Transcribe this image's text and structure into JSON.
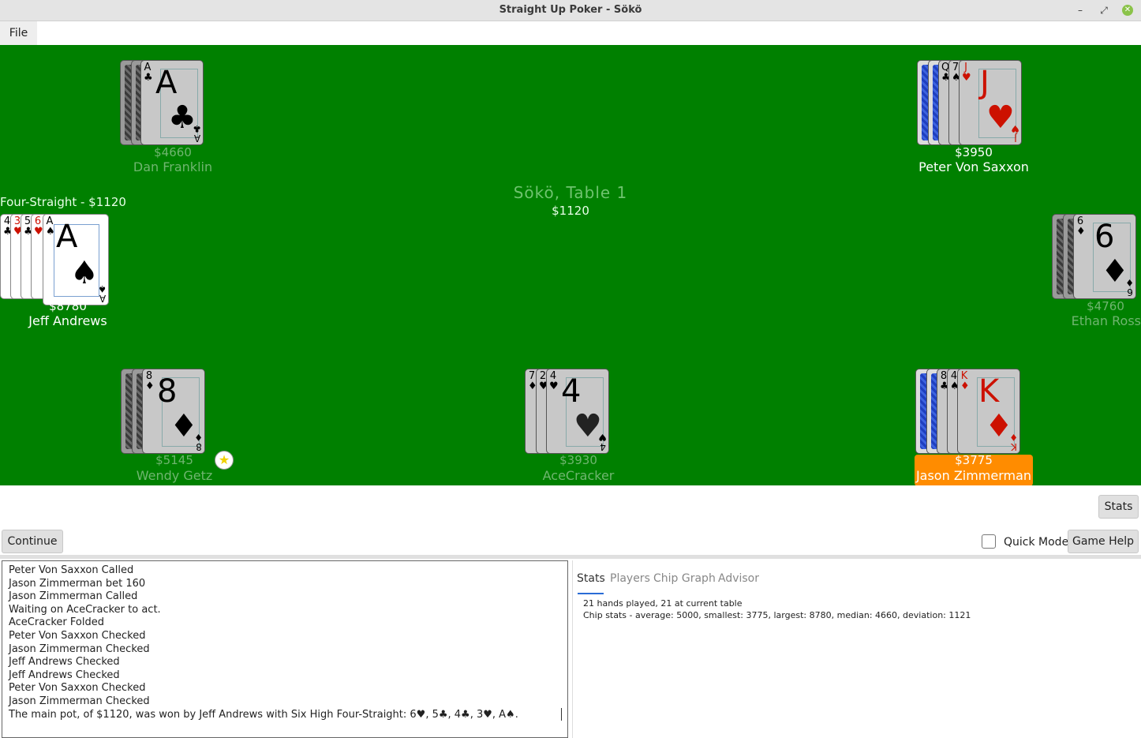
{
  "window": {
    "title": "Straight Up Poker - Sökö",
    "minimize_icon": "–",
    "restore_icon": "⤢",
    "close_icon": "✕"
  },
  "menu": {
    "file": "File"
  },
  "table": {
    "title": "Sökö, Table 1",
    "pot": "$1120",
    "winner_label": "Four-Straight - $1120"
  },
  "players": {
    "dan": {
      "name": "Dan Franklin",
      "chips": "$4660"
    },
    "peter": {
      "name": "Peter Von Saxxon",
      "chips": "$3950"
    },
    "jeff": {
      "name": "Jeff Andrews",
      "chips": "$8780"
    },
    "ethan": {
      "name": "Ethan Ross",
      "chips": "$4760"
    },
    "wendy": {
      "name": "Wendy Getz",
      "chips": "$5145"
    },
    "ace": {
      "name": "AceCracker",
      "chips": "$3930"
    },
    "jason": {
      "name": "Jason Zimmerman",
      "chips": "$3775"
    }
  },
  "cards": {
    "dan_top": {
      "rank": "A",
      "suit": "♣"
    },
    "peter_idx1": {
      "rank": "Q",
      "suit": "♣"
    },
    "peter_idx2": {
      "rank": "7",
      "suit": "♠"
    },
    "peter_top": {
      "rank": "J",
      "suit": "♥"
    },
    "jeff_1": {
      "rank": "4",
      "suit": "♣"
    },
    "jeff_2": {
      "rank": "3",
      "suit": "♥"
    },
    "jeff_3": {
      "rank": "5",
      "suit": "♣"
    },
    "jeff_4": {
      "rank": "6",
      "suit": "♥"
    },
    "jeff_top": {
      "rank": "A",
      "suit": "♠"
    },
    "ethan_top": {
      "rank": "6",
      "suit": "♦"
    },
    "wendy_top": {
      "rank": "8",
      "suit": "♦"
    },
    "ace_1": {
      "rank": "7",
      "suit": "♦"
    },
    "ace_2": {
      "rank": "2",
      "suit": "♥"
    },
    "ace_top": {
      "rank": "4",
      "suit": "♥"
    },
    "jason_1": {
      "rank": "8",
      "suit": "♣"
    },
    "jason_2": {
      "rank": "4",
      "suit": "♠"
    },
    "jason_top": {
      "rank": "K",
      "suit": "♦"
    }
  },
  "dealer_icon": "★",
  "controls": {
    "stats": "Stats",
    "continue": "Continue",
    "quick_mode": "Quick Mode",
    "game_help": "Game Help"
  },
  "log": [
    "Peter Von Saxxon Called",
    "Jason Zimmerman bet 160",
    "Jason Zimmerman Called",
    "Waiting on AceCracker to act.",
    "AceCracker Folded",
    "Peter Von Saxxon Checked",
    "Jason Zimmerman Checked",
    "Jeff Andrews Checked",
    "Jeff Andrews Checked",
    "Peter Von Saxxon Checked",
    "Jason Zimmerman Checked",
    "The main pot, of $1120, was won by Jeff Andrews with Six High Four-Straight: 6♥, 5♣, 4♣, 3♥, A♠."
  ],
  "tabs": [
    "Stats",
    "Players",
    "Chip Graph",
    "Advisor"
  ],
  "stats": {
    "line1": "21 hands played, 21 at current table",
    "line2": "Chip stats - average: 5000, smallest: 3775, largest: 8780, median: 4660, deviation: 1121"
  }
}
